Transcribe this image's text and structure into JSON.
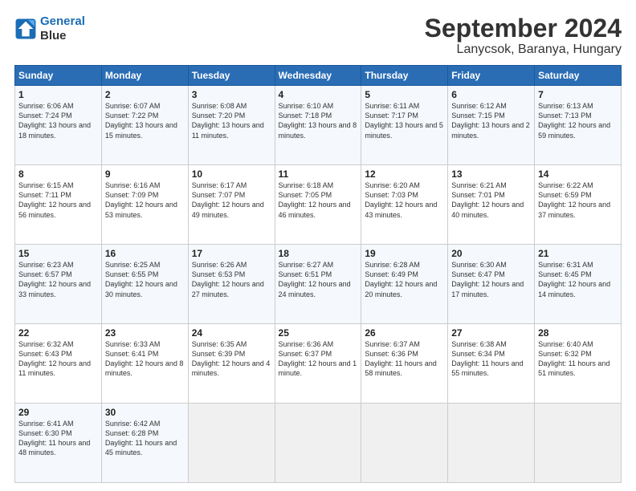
{
  "header": {
    "logo_line1": "General",
    "logo_line2": "Blue",
    "title": "September 2024",
    "subtitle": "Lanycsok, Baranya, Hungary"
  },
  "days_of_week": [
    "Sunday",
    "Monday",
    "Tuesday",
    "Wednesday",
    "Thursday",
    "Friday",
    "Saturday"
  ],
  "weeks": [
    [
      {
        "day": "1",
        "info": "Sunrise: 6:06 AM\nSunset: 7:24 PM\nDaylight: 13 hours and 18 minutes."
      },
      {
        "day": "2",
        "info": "Sunrise: 6:07 AM\nSunset: 7:22 PM\nDaylight: 13 hours and 15 minutes."
      },
      {
        "day": "3",
        "info": "Sunrise: 6:08 AM\nSunset: 7:20 PM\nDaylight: 13 hours and 11 minutes."
      },
      {
        "day": "4",
        "info": "Sunrise: 6:10 AM\nSunset: 7:18 PM\nDaylight: 13 hours and 8 minutes."
      },
      {
        "day": "5",
        "info": "Sunrise: 6:11 AM\nSunset: 7:17 PM\nDaylight: 13 hours and 5 minutes."
      },
      {
        "day": "6",
        "info": "Sunrise: 6:12 AM\nSunset: 7:15 PM\nDaylight: 13 hours and 2 minutes."
      },
      {
        "day": "7",
        "info": "Sunrise: 6:13 AM\nSunset: 7:13 PM\nDaylight: 12 hours and 59 minutes."
      }
    ],
    [
      {
        "day": "8",
        "info": "Sunrise: 6:15 AM\nSunset: 7:11 PM\nDaylight: 12 hours and 56 minutes."
      },
      {
        "day": "9",
        "info": "Sunrise: 6:16 AM\nSunset: 7:09 PM\nDaylight: 12 hours and 53 minutes."
      },
      {
        "day": "10",
        "info": "Sunrise: 6:17 AM\nSunset: 7:07 PM\nDaylight: 12 hours and 49 minutes."
      },
      {
        "day": "11",
        "info": "Sunrise: 6:18 AM\nSunset: 7:05 PM\nDaylight: 12 hours and 46 minutes."
      },
      {
        "day": "12",
        "info": "Sunrise: 6:20 AM\nSunset: 7:03 PM\nDaylight: 12 hours and 43 minutes."
      },
      {
        "day": "13",
        "info": "Sunrise: 6:21 AM\nSunset: 7:01 PM\nDaylight: 12 hours and 40 minutes."
      },
      {
        "day": "14",
        "info": "Sunrise: 6:22 AM\nSunset: 6:59 PM\nDaylight: 12 hours and 37 minutes."
      }
    ],
    [
      {
        "day": "15",
        "info": "Sunrise: 6:23 AM\nSunset: 6:57 PM\nDaylight: 12 hours and 33 minutes."
      },
      {
        "day": "16",
        "info": "Sunrise: 6:25 AM\nSunset: 6:55 PM\nDaylight: 12 hours and 30 minutes."
      },
      {
        "day": "17",
        "info": "Sunrise: 6:26 AM\nSunset: 6:53 PM\nDaylight: 12 hours and 27 minutes."
      },
      {
        "day": "18",
        "info": "Sunrise: 6:27 AM\nSunset: 6:51 PM\nDaylight: 12 hours and 24 minutes."
      },
      {
        "day": "19",
        "info": "Sunrise: 6:28 AM\nSunset: 6:49 PM\nDaylight: 12 hours and 20 minutes."
      },
      {
        "day": "20",
        "info": "Sunrise: 6:30 AM\nSunset: 6:47 PM\nDaylight: 12 hours and 17 minutes."
      },
      {
        "day": "21",
        "info": "Sunrise: 6:31 AM\nSunset: 6:45 PM\nDaylight: 12 hours and 14 minutes."
      }
    ],
    [
      {
        "day": "22",
        "info": "Sunrise: 6:32 AM\nSunset: 6:43 PM\nDaylight: 12 hours and 11 minutes."
      },
      {
        "day": "23",
        "info": "Sunrise: 6:33 AM\nSunset: 6:41 PM\nDaylight: 12 hours and 8 minutes."
      },
      {
        "day": "24",
        "info": "Sunrise: 6:35 AM\nSunset: 6:39 PM\nDaylight: 12 hours and 4 minutes."
      },
      {
        "day": "25",
        "info": "Sunrise: 6:36 AM\nSunset: 6:37 PM\nDaylight: 12 hours and 1 minute."
      },
      {
        "day": "26",
        "info": "Sunrise: 6:37 AM\nSunset: 6:36 PM\nDaylight: 11 hours and 58 minutes."
      },
      {
        "day": "27",
        "info": "Sunrise: 6:38 AM\nSunset: 6:34 PM\nDaylight: 11 hours and 55 minutes."
      },
      {
        "day": "28",
        "info": "Sunrise: 6:40 AM\nSunset: 6:32 PM\nDaylight: 11 hours and 51 minutes."
      }
    ],
    [
      {
        "day": "29",
        "info": "Sunrise: 6:41 AM\nSunset: 6:30 PM\nDaylight: 11 hours and 48 minutes."
      },
      {
        "day": "30",
        "info": "Sunrise: 6:42 AM\nSunset: 6:28 PM\nDaylight: 11 hours and 45 minutes."
      },
      {
        "day": "",
        "info": ""
      },
      {
        "day": "",
        "info": ""
      },
      {
        "day": "",
        "info": ""
      },
      {
        "day": "",
        "info": ""
      },
      {
        "day": "",
        "info": ""
      }
    ]
  ]
}
